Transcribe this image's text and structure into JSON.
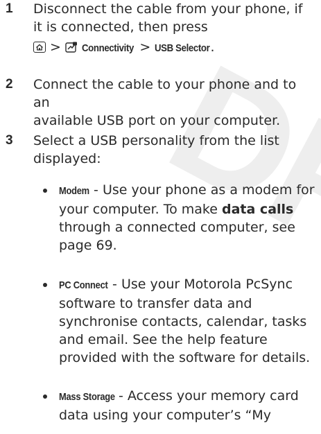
{
  "watermark": "DRAFT",
  "steps": [
    {
      "number": "1",
      "line1": "Disconnect the cable from your phone, if",
      "line2": "it is connected, then press",
      "sep1": ">",
      "path1": "Connectivity",
      "sep2": ">",
      "path2": "USB Selector",
      "end": ".",
      "icons": [
        "home-key-icon",
        "connectivity-menu-icon"
      ]
    },
    {
      "number": "2",
      "line1": "Connect the cable to your phone and to an",
      "line2": "available USB port on your computer."
    },
    {
      "number": "3",
      "line1": "Select a USB personality from the list",
      "line2": "displayed:"
    }
  ],
  "bullets": [
    {
      "term": "Modem",
      "l1": " - Use your phone as a modem for",
      "l2": "your computer. To make ",
      "bold": "data calls",
      "l3": "through a connected computer, see",
      "l4": "page 69."
    },
    {
      "term": "PC Connect",
      "l1": " - Use your Motorola PcSync",
      "l2": "software to transfer data and",
      "l3": "synchronise contacts, calendar, tasks",
      "l4": "and email. See the help feature",
      "l5": "provided with the software for details."
    },
    {
      "term": "Mass Storage",
      "l1": " - Access your memory card",
      "l2": "data using your computer’s “My"
    }
  ]
}
